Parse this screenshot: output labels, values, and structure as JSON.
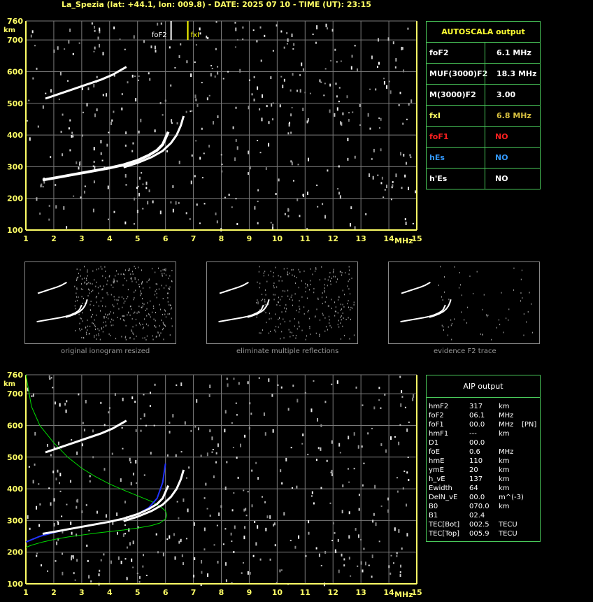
{
  "title": "La_Spezia (lat: +44.1, lon: 009.8) - DATE: 2025 07 10 - TIME (UT): 23:15",
  "colors": {
    "axis": "#ffff66",
    "grid": "#7a7a7a",
    "trace": "#ffffff",
    "panel_border": "#49c95a",
    "fof2_marker": "#ffff00",
    "green_profile": "#00dd00",
    "blue_trace": "#2233ff"
  },
  "chart_data": [
    {
      "type": "scatter",
      "name": "ionogram-main",
      "xlabel": "MHz",
      "ylabel": "km",
      "xlim": [
        1,
        15
      ],
      "ylim": [
        100,
        760
      ],
      "xticks": [
        1,
        2,
        3,
        4,
        5,
        6,
        7,
        8,
        9,
        10,
        11,
        12,
        13,
        14,
        15
      ],
      "yticks": [
        100,
        200,
        300,
        400,
        500,
        600,
        700,
        760
      ],
      "grid": true,
      "annotations": [
        {
          "text": "foF2",
          "x": 6.1
        },
        {
          "text": "fxI",
          "x": 6.8
        }
      ],
      "traces": [
        {
          "name": "o-trace",
          "x": [
            1.6,
            2.0,
            2.5,
            3.0,
            3.5,
            4.0,
            4.5,
            5.0,
            5.4,
            5.7,
            5.9,
            6.0,
            6.1
          ],
          "y": [
            258,
            264,
            272,
            280,
            288,
            296,
            306,
            320,
            336,
            352,
            370,
            390,
            410
          ]
        },
        {
          "name": "x-trace",
          "x": [
            4.5,
            5.0,
            5.5,
            5.9,
            6.2,
            6.4,
            6.55,
            6.65
          ],
          "y": [
            298,
            312,
            330,
            350,
            375,
            400,
            430,
            460
          ]
        },
        {
          "name": "second-hop",
          "x": [
            1.7,
            2.2,
            2.7,
            3.2,
            3.7,
            4.1,
            4.4,
            4.6
          ],
          "y": [
            515,
            530,
            545,
            560,
            575,
            590,
            605,
            615
          ]
        }
      ]
    },
    {
      "type": "scatter",
      "name": "ionogram-aip",
      "xlabel": "MHz",
      "ylabel": "km",
      "xlim": [
        1,
        15
      ],
      "ylim": [
        100,
        760
      ],
      "xticks": [
        1,
        2,
        3,
        4,
        5,
        6,
        7,
        8,
        9,
        10,
        11,
        12,
        13,
        14,
        15
      ],
      "yticks": [
        100,
        200,
        300,
        400,
        500,
        600,
        700,
        760
      ],
      "grid": true,
      "profiles": [
        {
          "name": "electron-density-profile",
          "x": [
            1.0,
            1.2,
            1.6,
            2.0,
            2.5,
            3.0,
            3.5,
            4.0,
            4.5,
            5.0,
            5.5,
            5.8,
            6.0,
            6.05,
            6.0,
            5.8,
            5.5,
            5.0,
            4.5,
            4.0,
            3.5,
            3.0,
            2.5,
            2.0,
            1.5,
            1.2,
            1.0
          ],
          "y": [
            215,
            222,
            232,
            240,
            248,
            254,
            260,
            265,
            270,
            276,
            284,
            292,
            305,
            317,
            330,
            345,
            360,
            378,
            396,
            415,
            438,
            465,
            500,
            545,
            600,
            660,
            760
          ]
        },
        {
          "name": "blue-fit",
          "x": [
            1.0,
            1.5,
            2.0,
            2.5,
            3.0,
            3.5,
            4.0,
            4.5,
            5.0,
            5.4,
            5.7,
            5.9,
            6.0
          ],
          "y": [
            232,
            250,
            262,
            272,
            280,
            288,
            296,
            306,
            320,
            340,
            370,
            420,
            480
          ]
        }
      ]
    }
  ],
  "autoscala": {
    "header": "AUTOSCALA output",
    "rows": [
      {
        "label": "foF2",
        "value": "6.1 MHz",
        "color": "#ffffff"
      },
      {
        "label": "MUF(3000)F2",
        "value": "18.3 MHz",
        "color": "#ffffff"
      },
      {
        "label": "M(3000)F2",
        "value": "3.00",
        "color": "#ffffff"
      },
      {
        "label": "fxI",
        "value": "6.8 MHz",
        "color": "#ffff66",
        "value_color": "#d8c040"
      },
      {
        "label": "foF1",
        "value": "NO",
        "color": "#ff2020"
      },
      {
        "label": "hEs",
        "value": "NO",
        "color": "#3399ff"
      },
      {
        "label": "h'Es",
        "value": "NO",
        "color": "#ffffff"
      }
    ]
  },
  "thumbnails": [
    {
      "caption": "original ionogram resized"
    },
    {
      "caption": "eliminate multiple reflections"
    },
    {
      "caption": "evidence F2 trace"
    }
  ],
  "aip": {
    "header": "AIP output",
    "rows": [
      {
        "param": "hmF2",
        "value": "317",
        "unit": "km",
        "extra": ""
      },
      {
        "param": "foF2",
        "value": "06.1",
        "unit": "MHz",
        "extra": ""
      },
      {
        "param": "foF1",
        "value": "00.0",
        "unit": "MHz",
        "extra": "[PN]"
      },
      {
        "param": "hmF1",
        "value": "---",
        "unit": "km",
        "extra": ""
      },
      {
        "param": "D1",
        "value": "00.0",
        "unit": "",
        "extra": ""
      },
      {
        "param": "foE",
        "value": "0.6",
        "unit": "MHz",
        "extra": ""
      },
      {
        "param": "hmE",
        "value": "110",
        "unit": "km",
        "extra": ""
      },
      {
        "param": "ymE",
        "value": "20",
        "unit": "km",
        "extra": ""
      },
      {
        "param": "h_vE",
        "value": "137",
        "unit": "km",
        "extra": ""
      },
      {
        "param": "Ewidth",
        "value": "64",
        "unit": "km",
        "extra": ""
      },
      {
        "param": "DelN_vE",
        "value": "00.0",
        "unit": "m^(-3)",
        "extra": ""
      },
      {
        "param": "B0",
        "value": "070.0",
        "unit": "km",
        "extra": ""
      },
      {
        "param": "B1",
        "value": "02.4",
        "unit": "",
        "extra": ""
      },
      {
        "param": "TEC[Bot]",
        "value": "002.5",
        "unit": "TECU",
        "extra": ""
      },
      {
        "param": "TEC[Top]",
        "value": "005.9",
        "unit": "TECU",
        "extra": ""
      }
    ]
  }
}
